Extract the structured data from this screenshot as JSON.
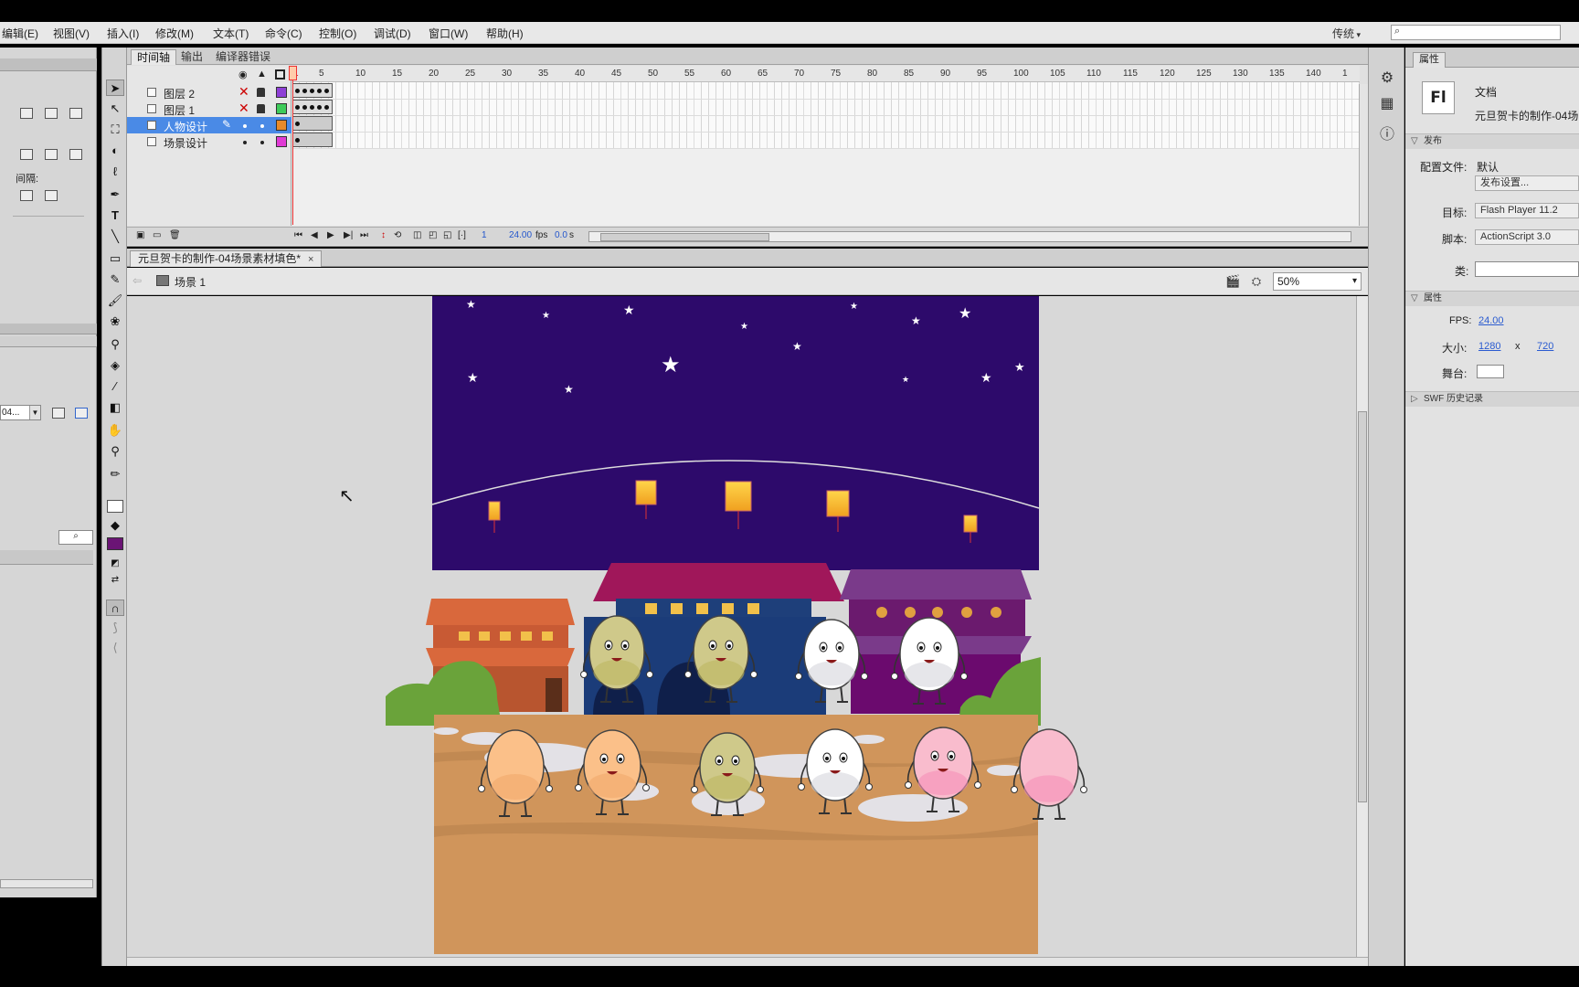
{
  "menu": {
    "items": [
      "编辑(E)",
      "视图(V)",
      "插入(I)",
      "修改(M)",
      "文本(T)",
      "命令(C)",
      "控制(O)",
      "调试(D)",
      "窗口(W)",
      "帮助(H)"
    ],
    "workspace": "传统",
    "search_icon": "⌕"
  },
  "left_panel": {
    "spacing_label": "间隔:",
    "dropdown_value": "04...",
    "search_icon": "⌕"
  },
  "timeline": {
    "tabs": [
      "时间轴",
      "输出",
      "编译器错误"
    ],
    "layers": [
      {
        "name": "图层 2",
        "color": "#8e3fd6"
      },
      {
        "name": "图层 1",
        "color": "#3ecb5a"
      },
      {
        "name": "人物设计",
        "color": "#e88a2a"
      },
      {
        "name": "场景设计",
        "color": "#e03ad4"
      }
    ],
    "ruler": [
      "1",
      "5",
      "10",
      "15",
      "20",
      "25",
      "30",
      "35",
      "40",
      "45",
      "50",
      "55",
      "60",
      "65",
      "70",
      "75",
      "80",
      "85",
      "90",
      "95",
      "100",
      "105",
      "110",
      "115",
      "120",
      "125",
      "130",
      "135",
      "140",
      "1"
    ],
    "current_frame": "1",
    "fps": "24.00",
    "fps_unit": "fps",
    "elapsed": "0.0",
    "elapsed_unit": "s"
  },
  "document": {
    "tab_title": "元旦贺卡的制作-04场景素材填色*",
    "tab_close": "×",
    "scene": "场景 1",
    "zoom": "50%"
  },
  "properties": {
    "tab": "属性",
    "doc_type": "文档",
    "doc_name": "元旦贺卡的制作-04场",
    "logo": "Fl",
    "publish_section": "发布",
    "profile_label": "配置文件:",
    "profile_value": "默认",
    "publish_settings_button": "发布设置...",
    "target_label": "目标:",
    "target_value": "Flash Player 11.2",
    "script_label": "脚本:",
    "script_value": "ActionScript 3.0",
    "class_label": "类:",
    "properties_section": "属性",
    "fps_label": "FPS:",
    "fps_value": "24.00",
    "size_label": "大小:",
    "width": "1280",
    "x_sep": "x",
    "height": "720",
    "stage_label": "舞台:",
    "swf_history": "SWF 历史记录"
  },
  "colors": {
    "sky": "#2d0a6b",
    "ground": "#d0955b",
    "fill_swatch": "#6b1475",
    "selected_layer": "#4a8ae6",
    "link": "#2a5bd0"
  }
}
